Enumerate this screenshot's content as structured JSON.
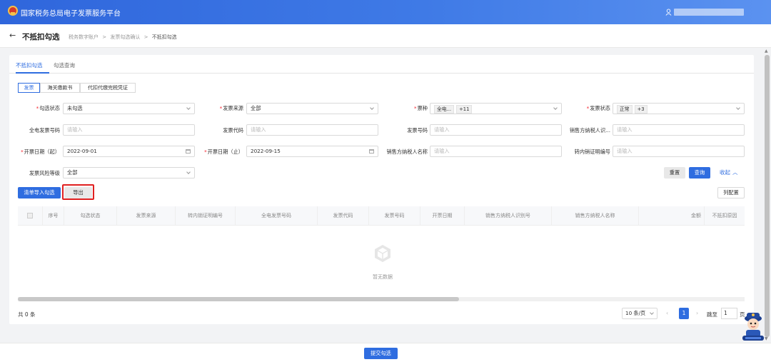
{
  "app": {
    "title": "国家税务总局电子发票服务平台"
  },
  "header": {
    "back_arrow": "←",
    "page_title": "不抵扣勾选"
  },
  "breadcrumb": {
    "items": [
      "税务数字账户",
      "发票勾选确认",
      "不抵扣勾选"
    ],
    "separator": ">"
  },
  "tabs": [
    {
      "label": "不抵扣勾选",
      "active": true
    },
    {
      "label": "勾选查询",
      "active": false
    }
  ],
  "invoice_types": [
    {
      "label": "发票",
      "active": true
    },
    {
      "label": "海关缴款书",
      "active": false
    },
    {
      "label": "代扣代缴完税凭证",
      "active": false
    }
  ],
  "form": {
    "check_status": {
      "label": "勾选状态",
      "required": true,
      "value": "未勾选"
    },
    "invoice_source": {
      "label": "发票来源",
      "required": true,
      "value": "全部"
    },
    "ticket_type": {
      "label": "票种",
      "required": true,
      "tag1": "全电...",
      "tag2": "+11"
    },
    "invoice_status": {
      "label": "发票状态",
      "required": true,
      "tag1": "正常",
      "tag2": "+3"
    },
    "fully_digital_no": {
      "label": "全电发票号码",
      "placeholder": "请输入"
    },
    "invoice_code": {
      "label": "发票代码",
      "placeholder": "请输入"
    },
    "invoice_number": {
      "label": "发票号码",
      "placeholder": "请输入"
    },
    "seller_tax_id": {
      "label": "销售方纳税人识...",
      "placeholder": "请输入"
    },
    "issue_date_start": {
      "label": "开票日期（起）",
      "required": true,
      "value": "2022-09-01"
    },
    "issue_date_end": {
      "label": "开票日期（止）",
      "required": true,
      "value": "2022-09-15"
    },
    "seller_name": {
      "label": "销售方纳税人名称",
      "placeholder": "请输入"
    },
    "transfer_cert_no": {
      "label": "转内销证明编号",
      "placeholder": "请输入"
    },
    "risk_level": {
      "label": "发票风险等级",
      "value": "全部"
    }
  },
  "buttons": {
    "reset": "重置",
    "query": "查询",
    "collapse": "收起",
    "import_check": "清单导入勾选",
    "export": "导出",
    "column_config": "列配置",
    "submit": "提交勾选"
  },
  "table": {
    "columns": [
      "序号",
      "勾选状态",
      "发票来源",
      "转内销证明编号",
      "全电发票号码",
      "发票代码",
      "发票号码",
      "开票日期",
      "销售方纳税人识别号",
      "销售方纳税人名称",
      "金额",
      "不抵扣原因"
    ],
    "rows": [],
    "empty_text": "暂无数据"
  },
  "pagination": {
    "total": "共 0 条",
    "page_size": "10 条/页",
    "current_page": "1",
    "jump_label": "跳至",
    "jump_value": "1",
    "page_unit": "页"
  },
  "colors": {
    "primary": "#2f6de0",
    "highlight": "#e02020",
    "required": "#f5222d"
  },
  "icons": {
    "user": "user-icon",
    "empty": "empty-box-icon",
    "mascot": "assistant-mascot"
  }
}
